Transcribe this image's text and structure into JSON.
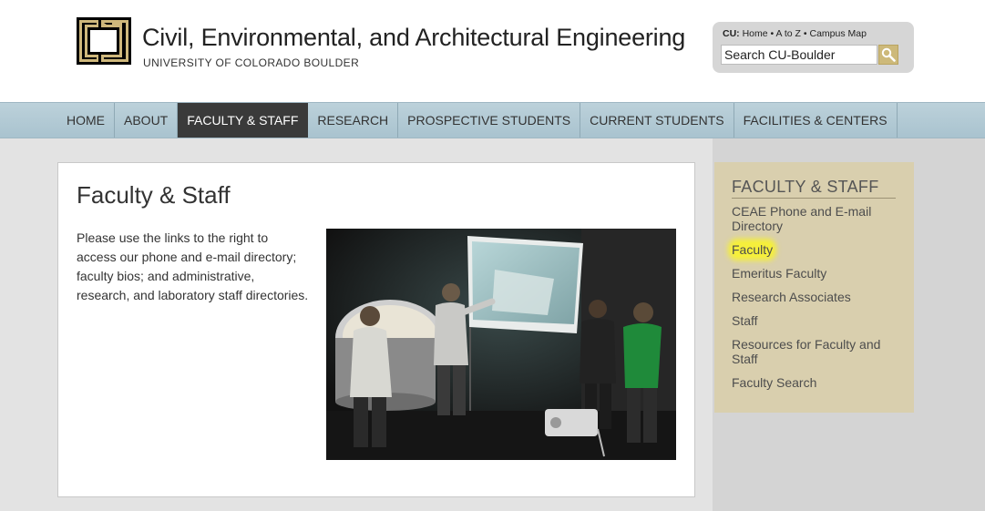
{
  "header": {
    "title": "Civil, Environmental, and Architectural Engineering",
    "subtitle": "UNIVERSITY OF COLORADO BOULDER",
    "cu_prefix": "CU:",
    "cu_links": [
      "Home",
      "A to Z",
      "Campus Map"
    ],
    "search_value": "Search CU-Boulder",
    "search_icon": "magnifier-icon",
    "logo": "cu-logo"
  },
  "nav": {
    "items": [
      "HOME",
      "ABOUT",
      "FACULTY & STAFF",
      "RESEARCH",
      "PROSPECTIVE STUDENTS",
      "CURRENT STUDENTS",
      "FACILITIES & CENTERS"
    ],
    "active": "FACULTY & STAFF"
  },
  "main": {
    "title": "Faculty & Staff",
    "intro": "Please use the links to the right to access our phone and e-mail directory; faculty bios; and administrative, research, and laboratory staff directories."
  },
  "sidebar": {
    "heading": "FACULTY & STAFF",
    "links": [
      "CEAE Phone and E-mail Directory",
      "Faculty",
      "Emeritus Faculty",
      "Research Associates",
      "Staff",
      "Resources for Faculty and Staff",
      "Faculty Search"
    ],
    "highlighted": "Faculty"
  },
  "colors": {
    "brand_gold": "#cfb87c",
    "nav_bg": "#b3cad4",
    "nav_active": "#3a3a3a",
    "sidebar_bg": "#d9cfae",
    "highlight": "#f5ef3c"
  }
}
